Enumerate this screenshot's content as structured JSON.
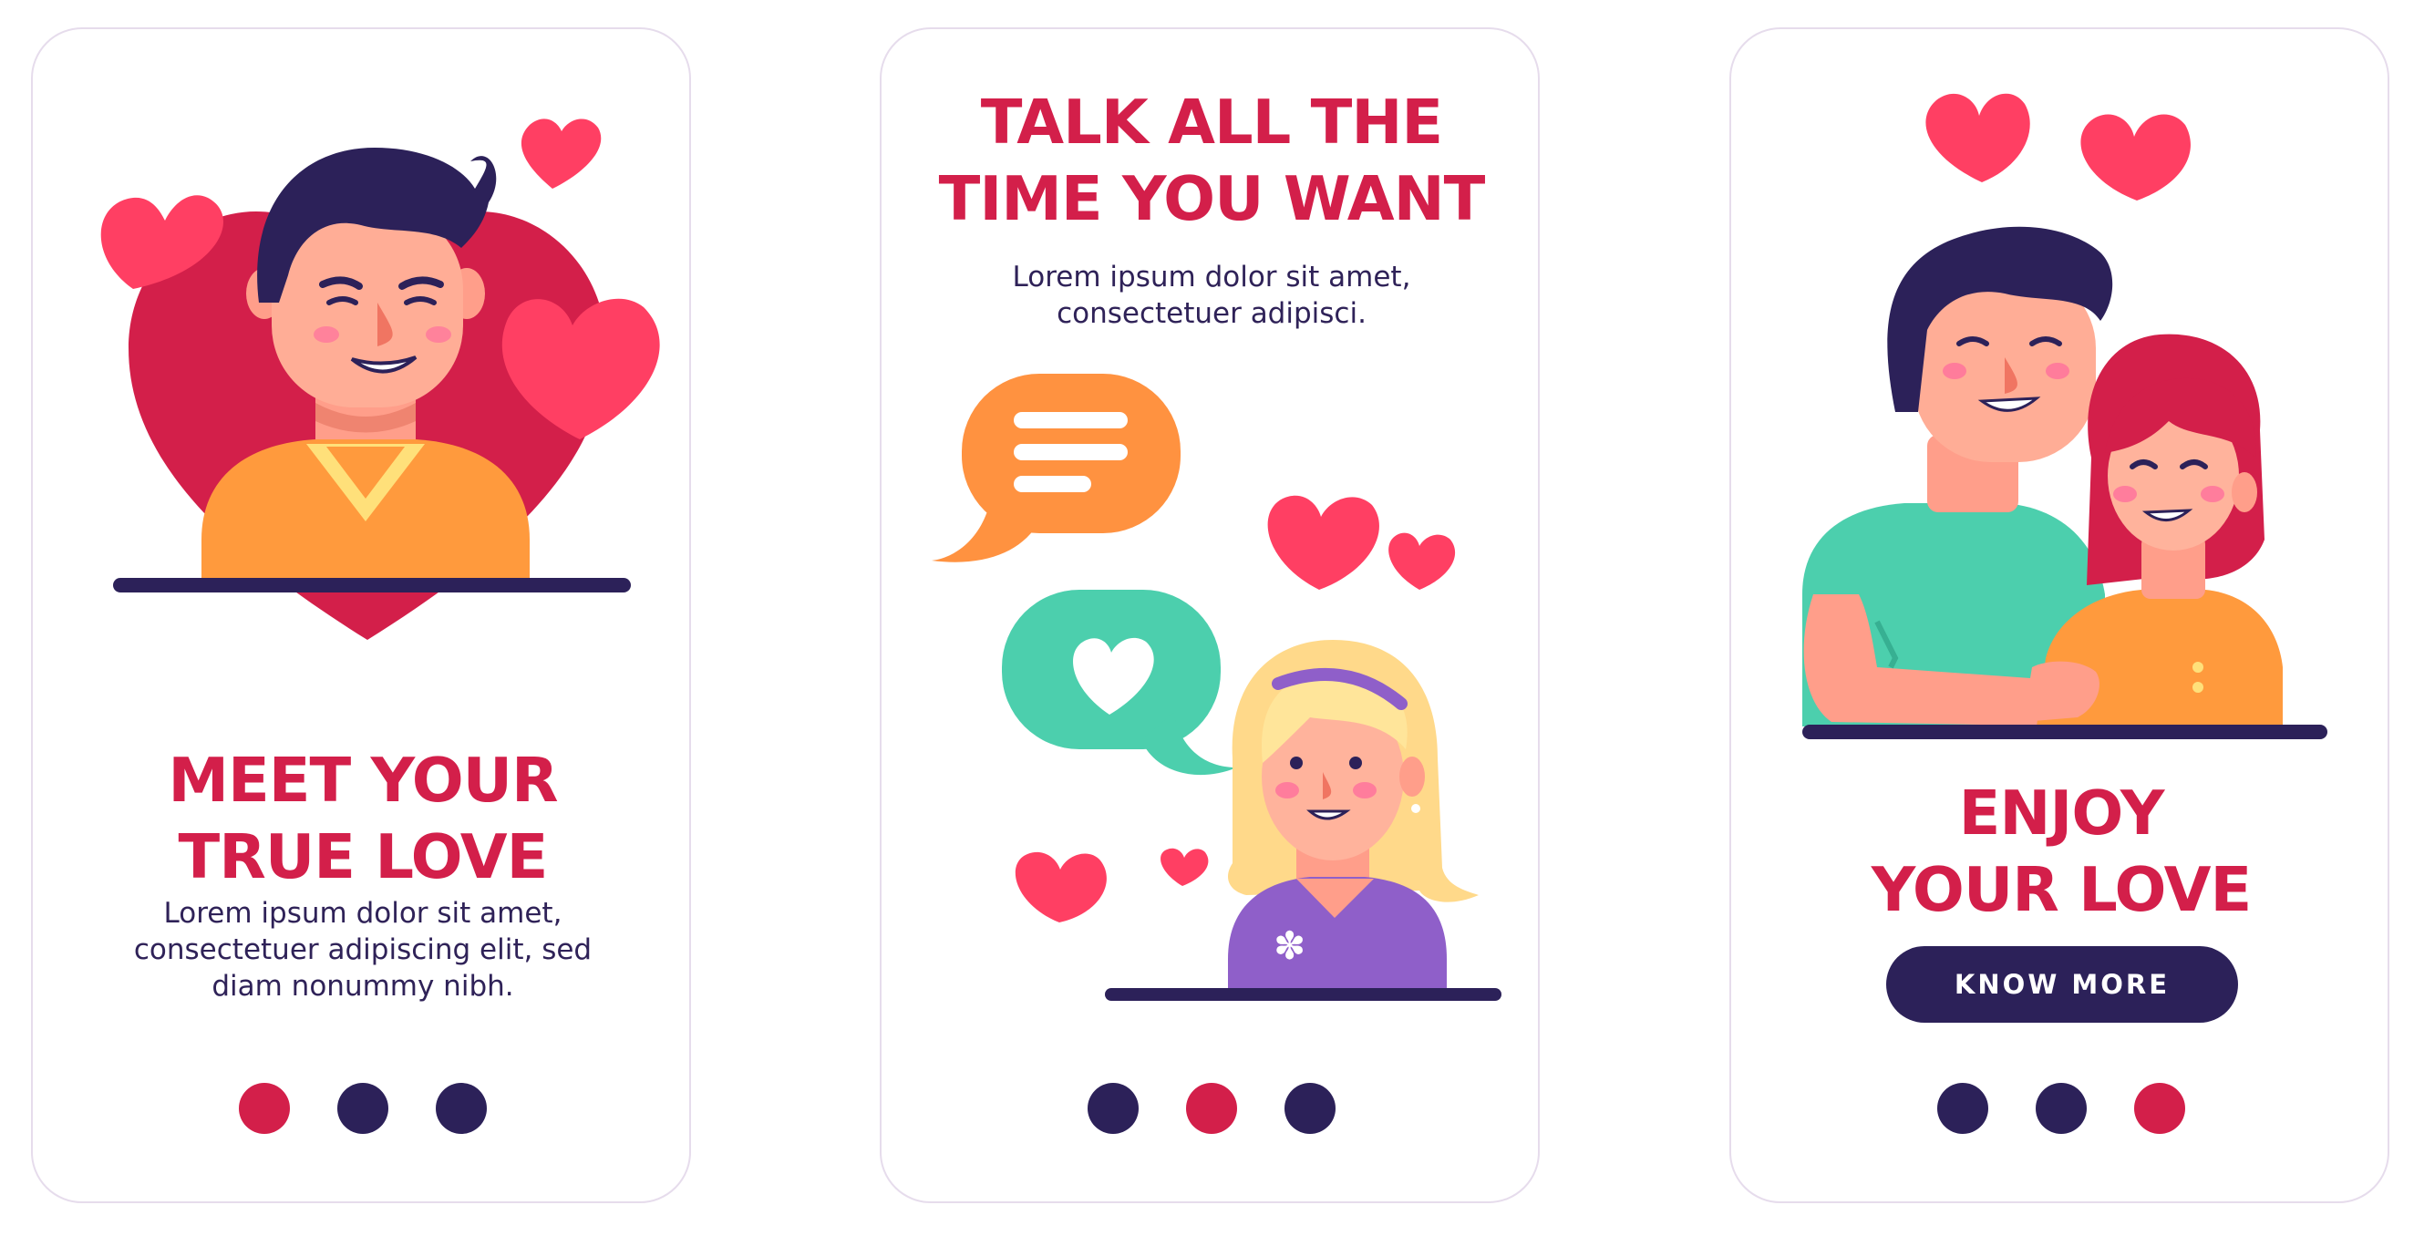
{
  "colors": {
    "accent": "#d31f4a",
    "navy": "#2c2159",
    "heart": "#ff3f63",
    "dot_active": "#d31f4a",
    "dot_inactive": "#2c2159"
  },
  "screens": [
    {
      "title_lines": [
        "MEET YOUR",
        "TRUE LOVE"
      ],
      "body_lines": [
        "Lorem ipsum dolor sit amet,",
        "consectetuer adipiscing elit, sed",
        "diam nonummy nibh."
      ],
      "active_dot": 0,
      "illustration": "man-portrait-with-hearts"
    },
    {
      "title_lines": [
        "TALK ALL THE",
        "TIME YOU WANT"
      ],
      "body_lines": [
        "Lorem ipsum dolor sit amet,",
        "consectetuer adipisci."
      ],
      "active_dot": 1,
      "illustration": "woman-with-chat-bubbles-and-hearts"
    },
    {
      "title_lines": [
        "ENJOY",
        "YOUR LOVE"
      ],
      "body_lines": [],
      "button_label": "KNOW MORE",
      "active_dot": 2,
      "illustration": "couple-hugging-with-hearts"
    }
  ],
  "dot_count": 3
}
